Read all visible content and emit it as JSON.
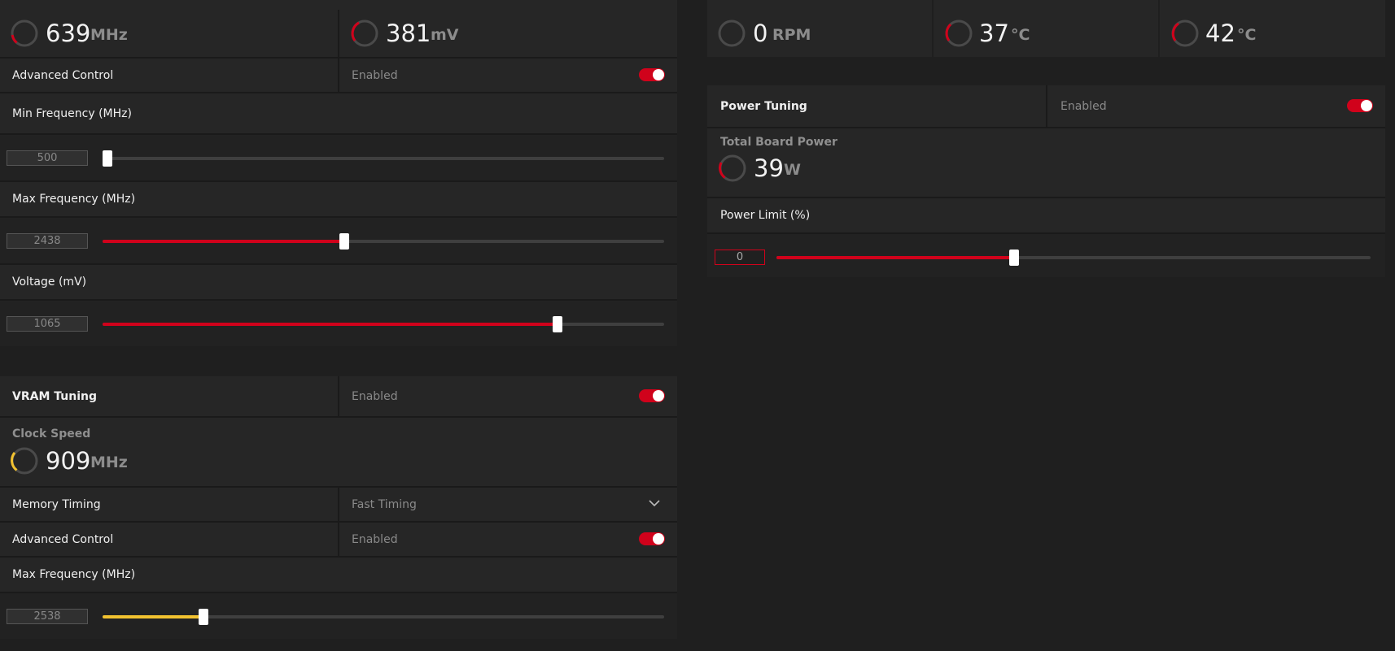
{
  "gpu": {
    "freq": {
      "value": "639",
      "unit": "MHz"
    },
    "volt": {
      "value": "381",
      "unit": "mV"
    },
    "advanced_control": {
      "label": "Advanced Control",
      "state": "Enabled",
      "enabled": true
    },
    "min_freq": {
      "label": "Min Frequency (MHz)",
      "value": "500",
      "level": 0.0
    },
    "max_freq": {
      "label": "Max Frequency (MHz)",
      "value": "2438",
      "level": 0.43
    },
    "voltage": {
      "label": "Voltage (mV)",
      "value": "1065",
      "level": 0.81
    }
  },
  "vram": {
    "title": "VRAM Tuning",
    "state": "Enabled",
    "enabled": true,
    "clock": {
      "label": "Clock Speed",
      "value": "909",
      "unit": "MHz"
    },
    "memory_timing": {
      "label": "Memory Timing",
      "value": "Fast Timing"
    },
    "advanced_control": {
      "label": "Advanced Control",
      "state": "Enabled",
      "enabled": true
    },
    "max_freq": {
      "label": "Max Frequency (MHz)",
      "value": "2538",
      "level": 0.18
    }
  },
  "fan": {
    "speed": {
      "value": "0",
      "unit": "RPM"
    },
    "temp1": {
      "value": "37",
      "unit": "°C"
    },
    "temp2": {
      "value": "42",
      "unit": "°C"
    }
  },
  "power": {
    "title": "Power Tuning",
    "state": "Enabled",
    "enabled": true,
    "board": {
      "label": "Total Board Power",
      "value": "39",
      "unit": "W"
    },
    "limit": {
      "label": "Power Limit (%)",
      "value": "0",
      "level": 0.4
    }
  },
  "colors": {
    "accent_red": "#d0021b",
    "accent_yellow": "#f2c230",
    "track": "#3f3f3f",
    "panel": "#262626"
  },
  "icons": {
    "toggle": "toggle-switch",
    "dropdown": "chevron-down-icon",
    "gauge": "gauge-icon"
  }
}
